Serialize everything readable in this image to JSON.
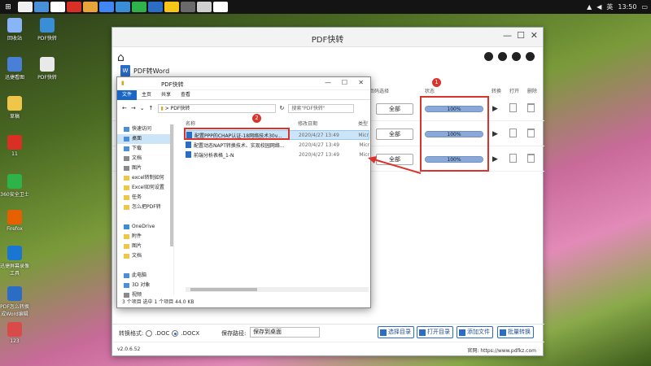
{
  "taskbar": {
    "tray_lang": "英",
    "clock": "13:50",
    "apps": [
      "#f0f0f0",
      "#4a90d9",
      "#ffffff",
      "#d93025",
      "#e9a33b",
      "#4285f4",
      "#3a8ed8",
      "#2db34a",
      "#2b6cc4",
      "#f5c518",
      "#6a6a6a",
      "#d0d0d0",
      "#ffffff"
    ]
  },
  "desktop": {
    "icons": [
      {
        "label": "回收站",
        "color": "#8ab4f8"
      },
      {
        "label": "PDF快转",
        "color": "#3a8ed8"
      },
      {
        "label": "迅捷看图",
        "color": "#4a7fd8"
      },
      {
        "label": "PDF快转",
        "color": "#e9e9e9"
      },
      {
        "label": "草稿",
        "color": "#f0c64a"
      },
      {
        "label": "11",
        "color": "#d93025"
      },
      {
        "label": "360安全卫士",
        "color": "#2db34a"
      },
      {
        "label": "Firefox",
        "color": "#e66000"
      },
      {
        "label": "迅捷屏幕录像工具",
        "color": "#1a76d2"
      },
      {
        "label": "PDF怎么转换成Word编辑",
        "color": "#2b6cc4"
      },
      {
        "label": "123",
        "color": "#d94a4a"
      }
    ]
  },
  "app": {
    "title": "PDF快转",
    "mode_label": "PDF转Word",
    "columns": {
      "scope": "页码选择",
      "status": "状态",
      "convert": "转换",
      "open": "打开",
      "delete": "删除"
    },
    "rows": [
      {
        "scope": "全部",
        "progress": 1.0,
        "progress_text": "100%"
      },
      {
        "scope": "全部",
        "progress": 1.0,
        "progress_text": "100%"
      },
      {
        "scope": "全部",
        "progress": 1.0,
        "progress_text": "100%"
      }
    ],
    "footer": {
      "format_label": "转换格式:",
      "opt_doc": ".DOC",
      "opt_docx": ".DOCX",
      "selected_format": "docx",
      "save_path_label": "保存路径:",
      "save_path_value": "保存到桌面",
      "buttons": [
        "选择目录",
        "打开目录",
        "添加文件",
        "批量转换"
      ]
    },
    "version": "v2.0.6.52",
    "website": "官网: https://www.pdfkz.com"
  },
  "dialog": {
    "title": "PDF快转",
    "ribbon_tabs": [
      "文件",
      "主页",
      "共享",
      "查看"
    ],
    "address_path": "PDF快转",
    "search_placeholder": "搜索\"PDF快转\"",
    "nav": [
      {
        "label": "快速访问",
        "color": "#4a90d9"
      },
      {
        "label": "桌面",
        "color": "#4a90d9"
      },
      {
        "label": "下载",
        "color": "#4a90d9"
      },
      {
        "label": "文档",
        "color": "#8a8a8a"
      },
      {
        "label": "图片",
        "color": "#8a8a8a"
      },
      {
        "label": "excel转制如何",
        "color": "#f0c64a"
      },
      {
        "label": "Excel如何设置",
        "color": "#f0c64a"
      },
      {
        "label": "任务",
        "color": "#f0c64a"
      },
      {
        "label": "怎么把PDF转",
        "color": "#f0c64a"
      },
      {
        "label": "",
        "color": "transparent"
      },
      {
        "label": "OneDrive",
        "color": "#3a8ed8"
      },
      {
        "label": "附件",
        "color": "#f0c64a"
      },
      {
        "label": "图片",
        "color": "#f0c64a"
      },
      {
        "label": "文档",
        "color": "#f0c64a"
      },
      {
        "label": "",
        "color": "transparent"
      },
      {
        "label": "此电脑",
        "color": "#4a90d9"
      },
      {
        "label": "3D 对象",
        "color": "#4a90d9"
      },
      {
        "label": "视频",
        "color": "#8a8a8a"
      }
    ],
    "columns": {
      "name": "名称",
      "date": "修改日期",
      "type": "类型"
    },
    "files": [
      {
        "name": "配置PPP的CHAP认证-18网络技术30v...",
        "date": "2020/4/27 13:49",
        "type": "Micr",
        "selected": true
      },
      {
        "name": "配置动态NAPT转换技术、实现校园网络...",
        "date": "2020/4/27 13:49",
        "type": "Micr",
        "selected": false
      },
      {
        "name": "前端分析表格_1-N",
        "date": "2020/4/27 13:49",
        "type": "Micr",
        "selected": false
      }
    ],
    "status": "3 个项目    选中 1 个项目  44.0 KB"
  },
  "annotations": {
    "badge1": "1",
    "badge2": "2",
    "highlight_color": "#d9332c"
  }
}
